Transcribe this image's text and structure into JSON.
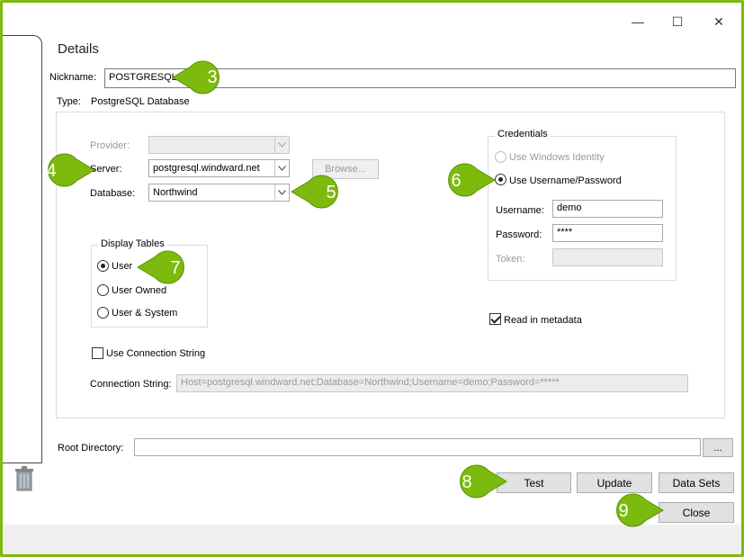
{
  "window": {
    "minimize_glyph": "—",
    "maximize_glyph": "☐",
    "close_glyph": "✕"
  },
  "details": {
    "title": "Details",
    "nickname_label": "Nickname:",
    "nickname_value": "POSTGRESQL",
    "type_label": "Type:",
    "type_value": "PostgreSQL Database"
  },
  "connection": {
    "provider_label": "Provider:",
    "provider_value": "",
    "server_label": "Server:",
    "server_value": "postgresql.windward.net",
    "database_label": "Database:",
    "database_value": "Northwind",
    "browse_label": "Browse..."
  },
  "credentials": {
    "title": "Credentials",
    "windows_identity_label": "Use Windows Identity",
    "username_password_label": "Use Username/Password",
    "selected": "Use Username/Password",
    "username_label": "Username:",
    "username_value": "demo",
    "password_label": "Password:",
    "password_value": "****",
    "token_label": "Token:",
    "token_value": ""
  },
  "display_tables": {
    "title": "Display Tables",
    "options": [
      "User",
      "User Owned",
      "User & System"
    ],
    "selected": "User"
  },
  "metadata": {
    "read_label": "Read in metadata",
    "checked": true
  },
  "conn_string": {
    "use_label": "Use Connection String",
    "checked": false,
    "label": "Connection String:",
    "value": "Host=postgresql.windward.net;Database=Northwind;Username=demo;Password=*****"
  },
  "root": {
    "label": "Root Directory:",
    "value": "",
    "browse_label": "..."
  },
  "buttons": {
    "test": "Test",
    "update": "Update",
    "datasets": "Data Sets",
    "close": "Close"
  },
  "callouts": {
    "c3": "3",
    "c4": "4",
    "c5": "5",
    "c6": "6",
    "c7": "7",
    "c8": "8",
    "c9": "9"
  },
  "colors": {
    "callout_green": "#7cbb0d",
    "frame_green": "#7cbb0d"
  }
}
